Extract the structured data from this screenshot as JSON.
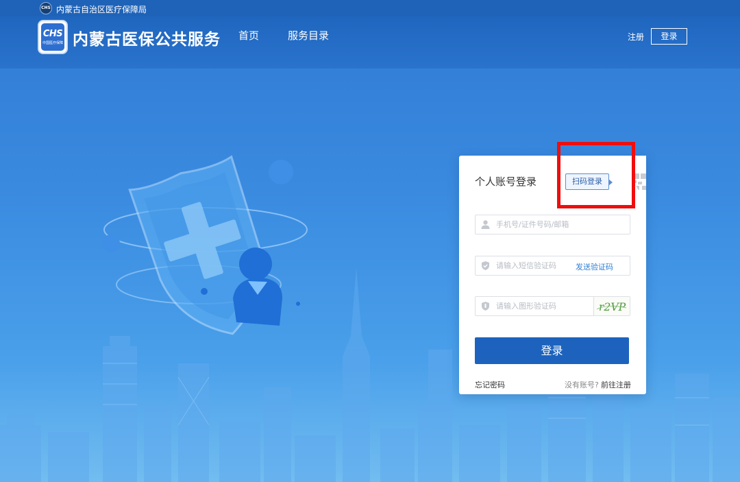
{
  "topbar": {
    "org_logo_text": "CHS",
    "org_name": "内蒙古自治区医疗保障局"
  },
  "header": {
    "logo_main": "CHS",
    "logo_sub": "中国医疗保障",
    "site_name": "内蒙古医保公共服务",
    "nav": [
      {
        "label": "首页"
      },
      {
        "label": "服务目录"
      }
    ],
    "register_label": "注册",
    "login_label": "登录"
  },
  "login": {
    "title": "个人账号登录",
    "scan_tip": "扫码登录",
    "account_placeholder": "手机号/证件号码/邮箱",
    "sms_placeholder": "请输入短信验证码",
    "send_code_label": "发送验证码",
    "captcha_placeholder": "请输入图形验证码",
    "captcha_text": "r2VP",
    "submit_label": "登录",
    "forgot_label": "忘记密码",
    "no_account_label": "没有账号?",
    "go_register_label": "前往注册"
  },
  "colors": {
    "primary": "#1d63bd",
    "header": "#1f66bf",
    "link": "#2f7fd7",
    "annotation": "#f00d0d"
  }
}
